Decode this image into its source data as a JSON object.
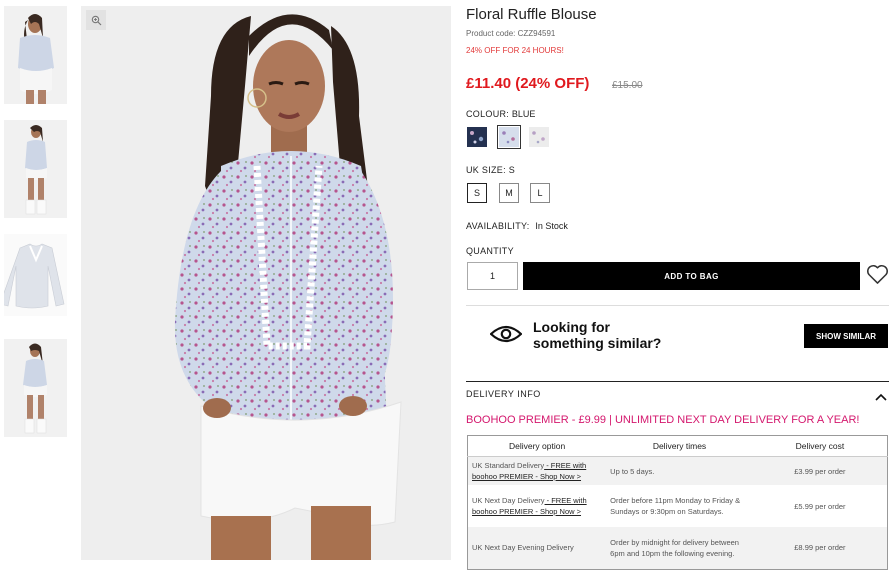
{
  "product": {
    "title": "Floral Ruffle Blouse",
    "code": "Product code: CZZ94591",
    "promo": "24% OFF FOR 24 HOURS!",
    "price_now": "£11.40 (24% OFF)",
    "price_was": "£15.00"
  },
  "colour": {
    "label": "COLOUR:",
    "value": "BLUE"
  },
  "size": {
    "label": "UK SIZE:",
    "value": "S",
    "options": [
      "S",
      "M",
      "L"
    ]
  },
  "availability": {
    "label": "AVAILABILITY:",
    "value": "In Stock"
  },
  "quantity": {
    "label": "QUANTITY",
    "value": "1"
  },
  "add_to_bag": "ADD TO BAG",
  "similar": {
    "line1": "Looking for",
    "line2": "something similar?",
    "button": "SHOW SIMILAR"
  },
  "delivery": {
    "header": "DELIVERY INFO",
    "premier": "BOOHOO PREMIER - £9.99 | UNLIMITED NEXT DAY DELIVERY FOR A YEAR!",
    "columns": [
      "Delivery option",
      "Delivery times",
      "Delivery cost"
    ],
    "rows": [
      {
        "option": "UK Standard Delivery",
        "link": " - FREE with boohoo PREMIER - Shop Now >",
        "times": "Up to 5 days.",
        "cost": "£3.99 per order"
      },
      {
        "option": "UK Next Day Delivery",
        "link": " - FREE with boohoo PREMIER - Shop Now >",
        "times": "Order before 11pm Monday to Friday & Sundays or 9:30pm on Saturdays.",
        "cost": "£5.99 per order"
      },
      {
        "option": "UK Next Day Evening Delivery",
        "link": "",
        "times": "Order by midnight for delivery between 6pm and 10pm the following evening.",
        "cost": "£8.99 per order"
      }
    ]
  },
  "colors": {
    "price": "#e0191e",
    "promo": "#e23a3a",
    "premier": "#d4176d",
    "button": "#000000"
  },
  "icons": {
    "zoom": "zoom-icon",
    "wishlist": "heart-icon",
    "eye": "eye-icon",
    "collapse": "chevron-up-icon"
  }
}
